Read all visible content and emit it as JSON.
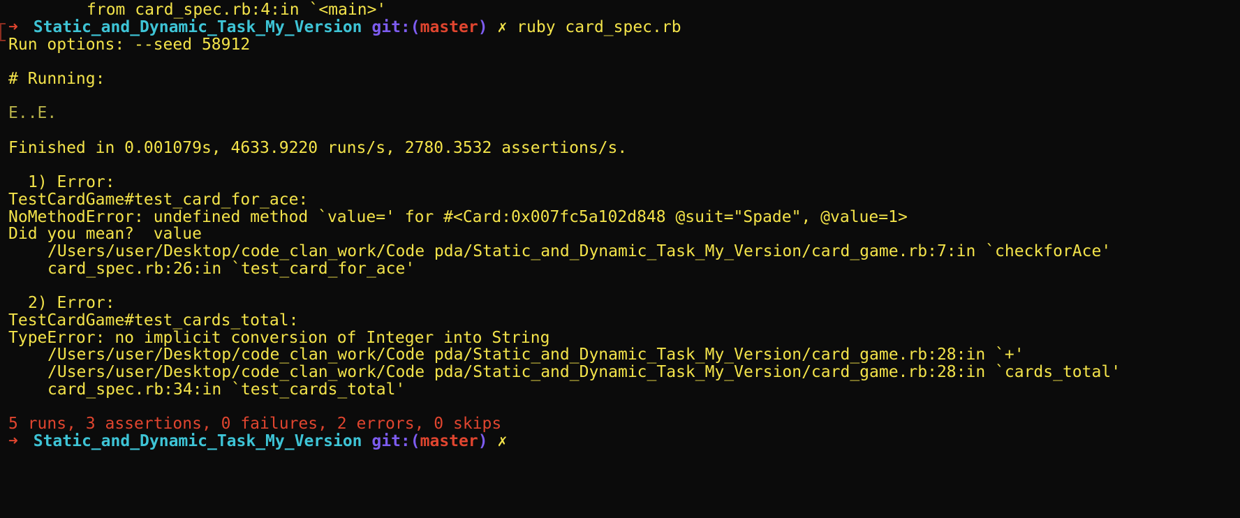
{
  "terminal": {
    "prev_from_line": "from card_spec.rb:4:in `<main>'",
    "prompt1": {
      "arrow": "➜",
      "dir": "Static_and_Dynamic_Task_My_Version",
      "git": "git:",
      "paren_open": "(",
      "branch": "master",
      "paren_close": ")",
      "dirty": "✗",
      "command": "ruby card_spec.rb"
    },
    "run_options": "Run options: --seed 58912",
    "running": "# Running:",
    "progress": "E..E.",
    "finished": "Finished in 0.001079s, 4633.9220 runs/s, 2780.3532 assertions/s.",
    "error1": {
      "header": "1) Error:",
      "test": "TestCardGame#test_card_for_ace:",
      "message": "NoMethodError: undefined method `value=' for #<Card:0x007fc5a102d848 @suit=\"Spade\", @value=1>",
      "hint": "Did you mean?  value",
      "trace1": "/Users/user/Desktop/code_clan_work/Code pda/Static_and_Dynamic_Task_My_Version/card_game.rb:7:in `checkforAce'",
      "trace2": "card_spec.rb:26:in `test_card_for_ace'"
    },
    "error2": {
      "header": "2) Error:",
      "test": "TestCardGame#test_cards_total:",
      "message": "TypeError: no implicit conversion of Integer into String",
      "trace1": "/Users/user/Desktop/code_clan_work/Code pda/Static_and_Dynamic_Task_My_Version/card_game.rb:28:in `+'",
      "trace2": "/Users/user/Desktop/code_clan_work/Code pda/Static_and_Dynamic_Task_My_Version/card_game.rb:28:in `cards_total'",
      "trace3": "card_spec.rb:34:in `test_cards_total'"
    },
    "summary": "5 runs, 3 assertions, 0 failures, 2 errors, 0 skips",
    "prompt2": {
      "arrow": "➜",
      "dir": "Static_and_Dynamic_Task_My_Version",
      "git": "git:",
      "paren_open": "(",
      "branch": "master",
      "paren_close": ")",
      "dirty": "✗"
    },
    "colors": {
      "background": "#0b0b0b",
      "text": "#f3e34a",
      "arrow": "#e0452f",
      "directory": "#3ec4d6",
      "git": "#7d5cf0",
      "branch": "#e0452f",
      "summary": "#e0452f"
    }
  }
}
